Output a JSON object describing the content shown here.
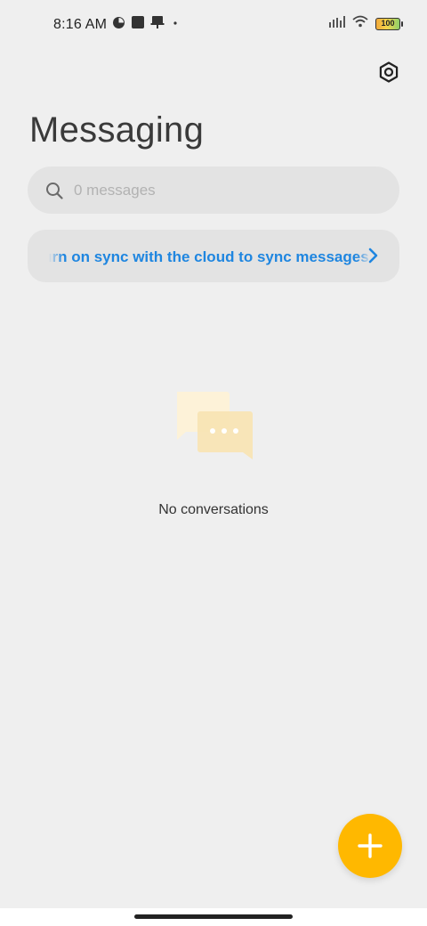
{
  "status_bar": {
    "time": "8:16 AM",
    "left_icons": [
      "pie-chart-icon",
      "square-app-icon",
      "pin-icon",
      "dot-icon"
    ],
    "right_icons": [
      "signal-icon",
      "wifi-icon",
      "battery-icon"
    ],
    "battery_level": "100"
  },
  "header": {
    "title": "Messaging",
    "settings_icon": "settings-hex-icon"
  },
  "search": {
    "placeholder": "0 messages",
    "icon": "search-icon"
  },
  "sync_banner": {
    "text": "Turn on sync with the cloud to sync messages",
    "icon": "chevron-right-icon",
    "color": "#1f86e0"
  },
  "empty_state": {
    "icon": "chat-bubbles-icon",
    "text": "No conversations"
  },
  "fab": {
    "icon": "plus-icon",
    "color": "#ffb800"
  }
}
